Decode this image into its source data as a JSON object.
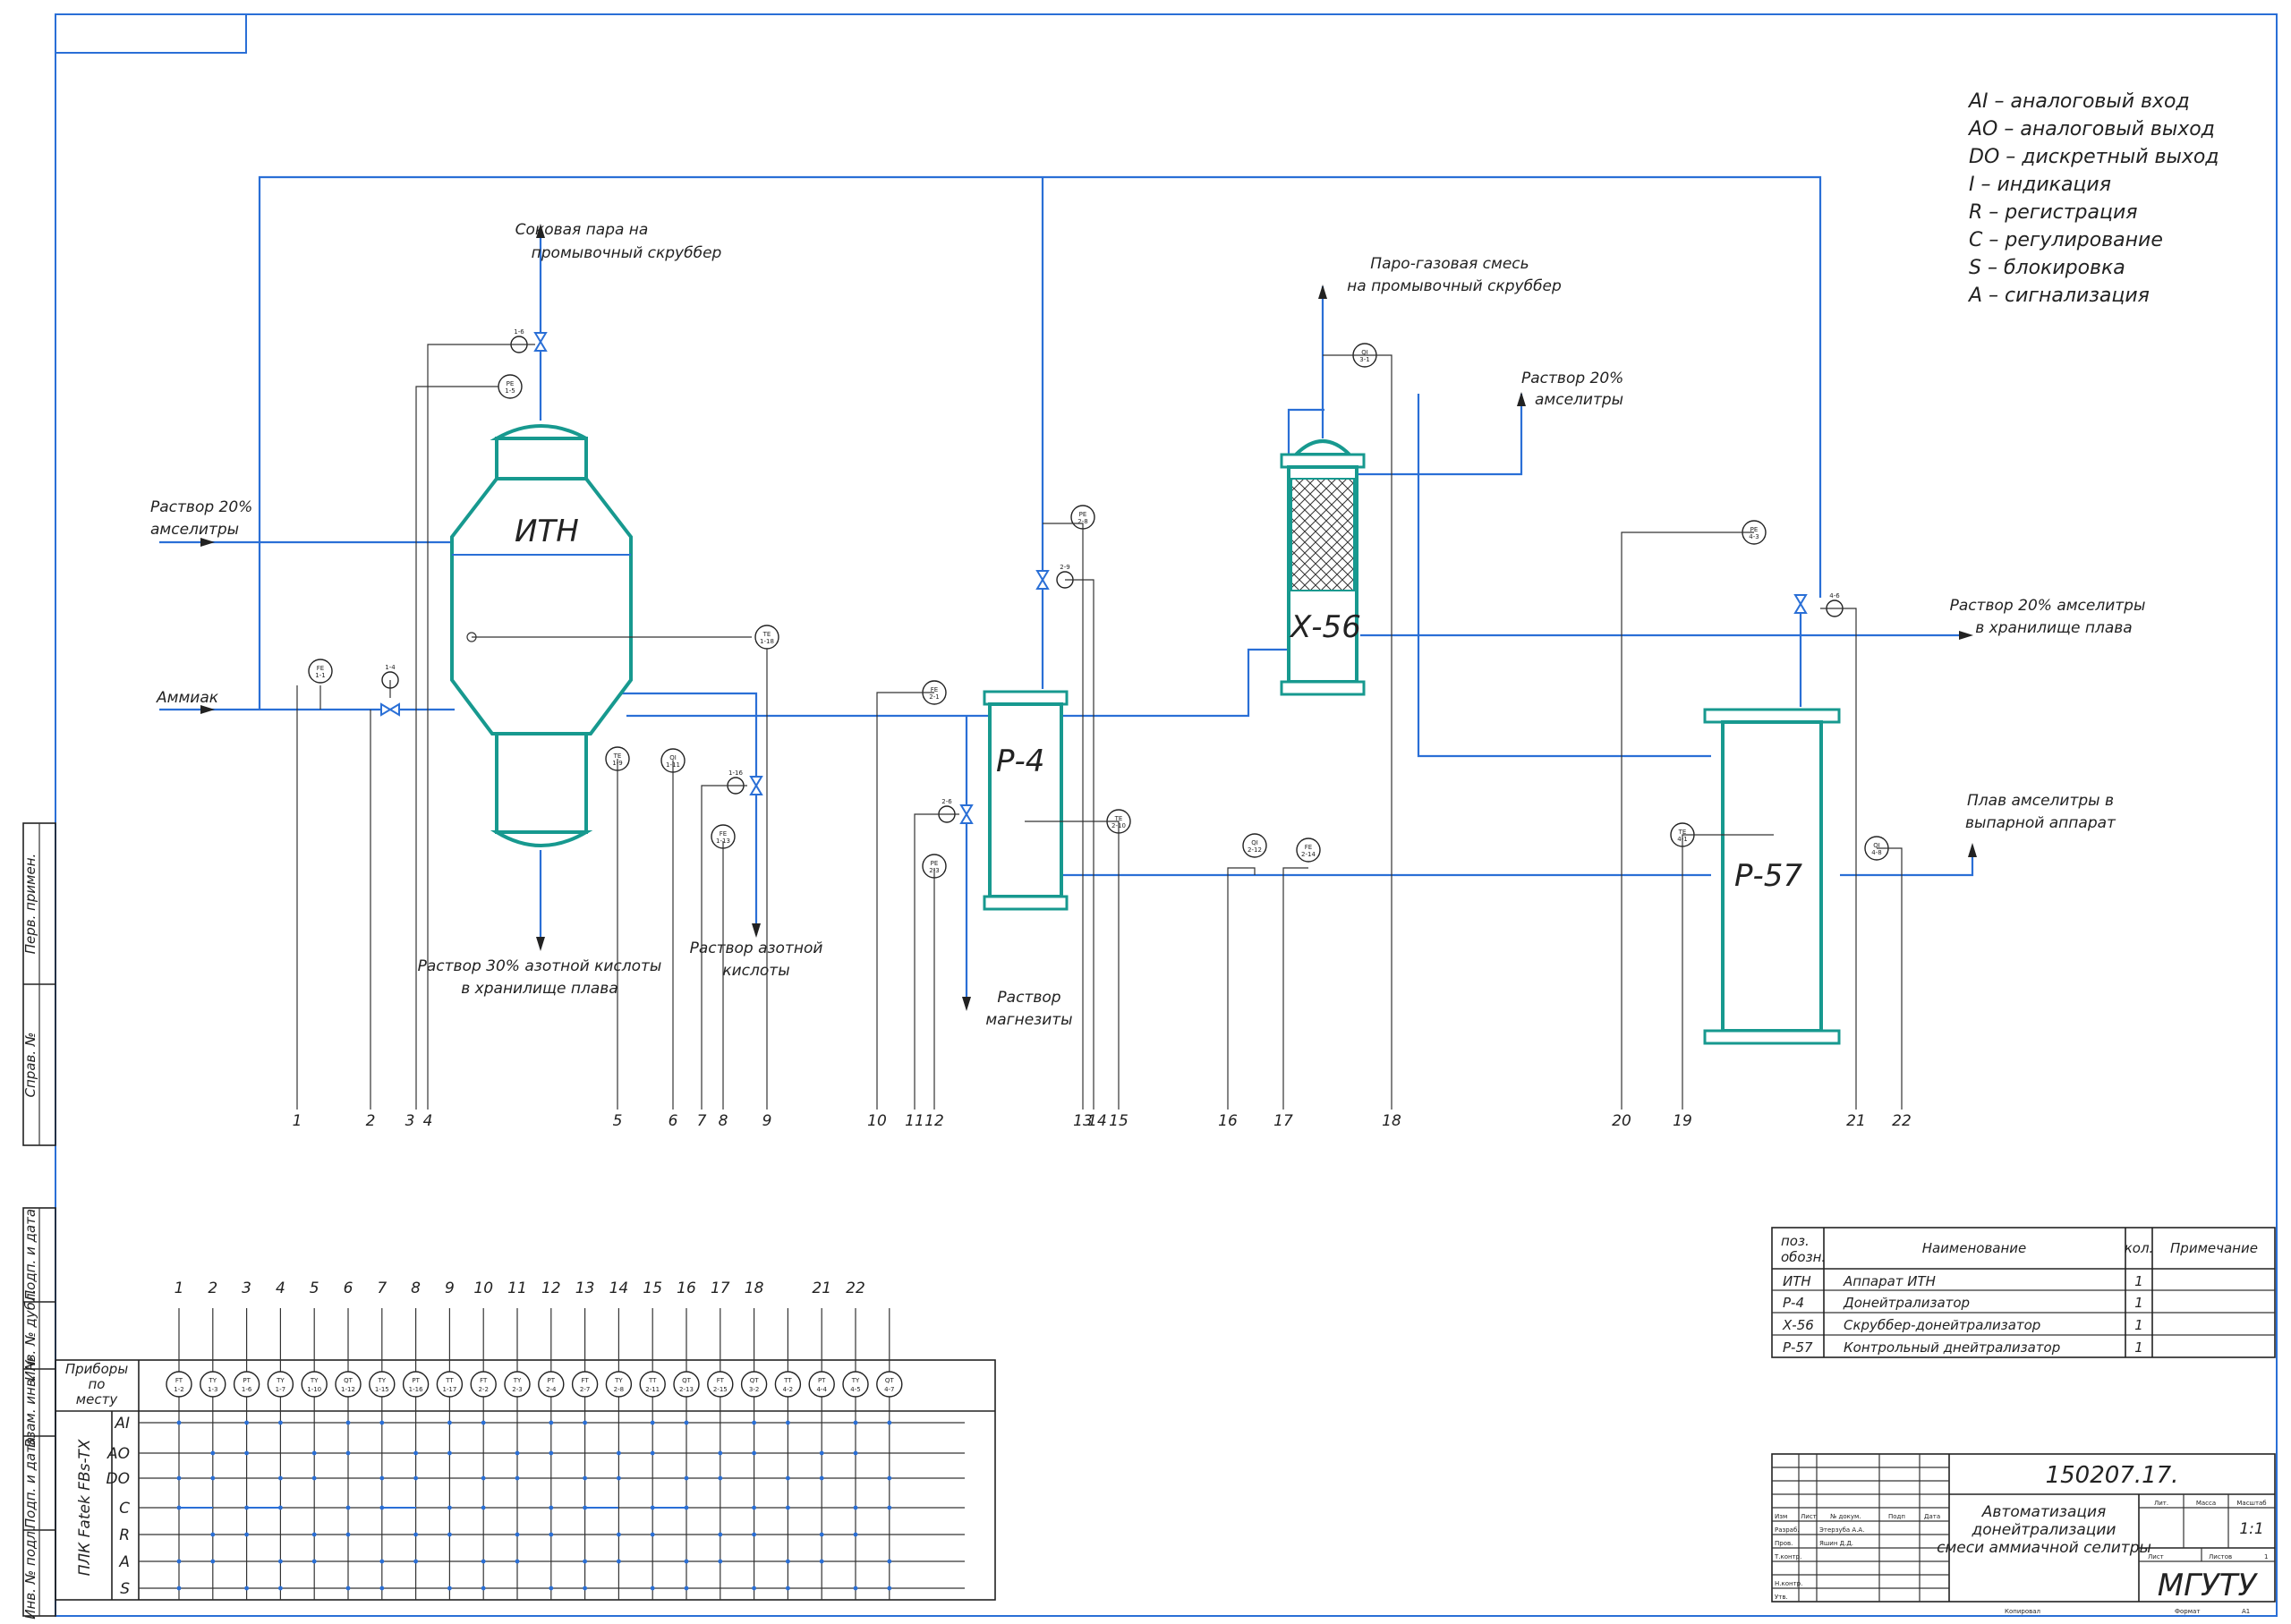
{
  "legend": [
    "AI – аналоговый вход",
    "AO – аналоговый выход",
    "DO – дискретный выход",
    "I – индикация",
    "R – регистрация",
    "C – регулирование",
    "S – блокировка",
    "A – сигнализация"
  ],
  "equipment": {
    "itn": "ИТН",
    "p4": "Р-4",
    "x56": "Х-56",
    "p57": "Р-57"
  },
  "streams": {
    "juice_steam": [
      "Соковая пара на",
      "промывочный скруббер"
    ],
    "gas_mix": [
      "Паро-газовая смесь",
      "на промывочный скруббер"
    ],
    "solution_in": [
      "Раствор 20%",
      "амселитры"
    ],
    "ammonia": "Аммиак",
    "solution_x56": [
      "Раствор 20%",
      "амселитры"
    ],
    "acid30": [
      "Раствор 30% азотной кислоты",
      "в хранилище плава"
    ],
    "nitric": [
      "Раствор азотной",
      "кислоты"
    ],
    "magnesia": [
      "Раствор",
      "магнезиты"
    ],
    "to_storage": [
      "Раствор 20% амселитры",
      "в хранилище плава"
    ],
    "melt": [
      "Плав амселитры в",
      "выпарной аппарат"
    ]
  },
  "instruments": [
    {
      "id": "i1",
      "l1": "FE",
      "l2": "1-1"
    },
    {
      "id": "i2",
      "l1": "",
      "l2": "1-4"
    },
    {
      "id": "i3",
      "l1": "",
      "l2": "1-6"
    },
    {
      "id": "i4",
      "l1": "PE",
      "l2": "1-5"
    },
    {
      "id": "i5",
      "l1": "TE",
      "l2": "1-9"
    },
    {
      "id": "i6",
      "l1": "QI",
      "l2": "1-11"
    },
    {
      "id": "i7",
      "l1": "",
      "l2": "1-16"
    },
    {
      "id": "i8",
      "l1": "FE",
      "l2": "1-13"
    },
    {
      "id": "i9",
      "l1": "TE",
      "l2": "1-18"
    },
    {
      "id": "i10",
      "l1": "FE",
      "l2": "2-1"
    },
    {
      "id": "i11",
      "l1": "",
      "l2": "2-6"
    },
    {
      "id": "i12",
      "l1": "PE",
      "l2": "2-3"
    },
    {
      "id": "i13",
      "l1": "PE",
      "l2": "2-8"
    },
    {
      "id": "i14",
      "l1": "",
      "l2": "2-9"
    },
    {
      "id": "i15",
      "l1": "TE",
      "l2": "2-10"
    },
    {
      "id": "i16",
      "l1": "QI",
      "l2": "2-12"
    },
    {
      "id": "i17",
      "l1": "FE",
      "l2": "2-14"
    },
    {
      "id": "i18",
      "l1": "QI",
      "l2": "3-1"
    },
    {
      "id": "i19",
      "l1": "TE",
      "l2": "4-1"
    },
    {
      "id": "i20",
      "l1": "PE",
      "l2": "4-3"
    },
    {
      "id": "i21",
      "l1": "",
      "l2": "4-6"
    },
    {
      "id": "i22",
      "l1": "QI",
      "l2": "4-8"
    }
  ],
  "line_numbers": [
    "1",
    "2",
    "3",
    "4",
    "5",
    "6",
    "7",
    "8",
    "9",
    "10",
    "11",
    "12",
    "13",
    "14",
    "15",
    "16",
    "17",
    "18",
    "20",
    "19",
    "21",
    "22"
  ],
  "bottom": {
    "top_numbers": [
      "1",
      "2",
      "3",
      "4",
      "5",
      "6",
      "7",
      "8",
      "9",
      "10",
      "11",
      "12",
      "13",
      "14",
      "15",
      "16",
      "17",
      "18",
      "21",
      "22"
    ],
    "devices_header": [
      "Приборы",
      "по",
      "месту"
    ],
    "plc_label": "ПЛК Fatek FBs-TX",
    "signals": [
      "AI",
      "AO",
      "DO",
      "C",
      "R",
      "A",
      "S"
    ],
    "devices": [
      {
        "l1": "FT",
        "l2": "1-2"
      },
      {
        "l1": "TY",
        "l2": "1-3"
      },
      {
        "l1": "PT",
        "l2": "1-6"
      },
      {
        "l1": "TY",
        "l2": "1-7"
      },
      {
        "l1": "TY",
        "l2": "1-10"
      },
      {
        "l1": "QT",
        "l2": "1-12"
      },
      {
        "l1": "TY",
        "l2": "1-15"
      },
      {
        "l1": "PT",
        "l2": "1-16"
      },
      {
        "l1": "TT",
        "l2": "1-17"
      },
      {
        "l1": "FT",
        "l2": "2-2"
      },
      {
        "l1": "TY",
        "l2": "2-3"
      },
      {
        "l1": "PT",
        "l2": "2-4"
      },
      {
        "l1": "FT",
        "l2": "2-7"
      },
      {
        "l1": "TY",
        "l2": "2-8"
      },
      {
        "l1": "TT",
        "l2": "2-11"
      },
      {
        "l1": "QT",
        "l2": "2-13"
      },
      {
        "l1": "FT",
        "l2": "2-15"
      },
      {
        "l1": "QT",
        "l2": "3-2"
      },
      {
        "l1": "TT",
        "l2": "4-2"
      },
      {
        "l1": "PT",
        "l2": "4-4"
      },
      {
        "l1": "TY",
        "l2": "4-5"
      },
      {
        "l1": "QT",
        "l2": "4-7"
      }
    ]
  },
  "spec": {
    "headers": [
      "поз.",
      "обозн.",
      "Наименование",
      "кол.",
      "Примечание"
    ],
    "rows": [
      {
        "pos": "ИТН",
        "name": "Аппарат ИТН",
        "qty": "1"
      },
      {
        "pos": "Р-4",
        "name": "Донейтрализатор",
        "qty": "1"
      },
      {
        "pos": "Х-56",
        "name": "Скруббер-донейтрализатор",
        "qty": "1"
      },
      {
        "pos": "Р-57",
        "name": "Контрольный днейтрализатор",
        "qty": "1"
      }
    ]
  },
  "stamp": {
    "code": "150207.17.",
    "title": [
      "Автоматизация",
      "донейтрализации",
      "смеси аммиачной селитры"
    ],
    "col_headers": [
      "Изм",
      "Лист",
      "№ докум.",
      "Подп",
      "Дата"
    ],
    "roles": [
      "Разраб.",
      "Пров.",
      "Т.контр.",
      "Н.контр.",
      "Утв."
    ],
    "names": [
      "Этерзуба А.А.",
      "Яшин Д.Д."
    ],
    "lit": "Лит.",
    "mass": "Масса",
    "scale": "Масштаб",
    "scale_value": "1:1",
    "sheet": "Лист",
    "sheets": "Листов",
    "sheets_value": "1",
    "org": "МГУТУ",
    "copied": "Копировал",
    "format": "Формат",
    "format_value": "А1"
  },
  "side_labels": [
    "Перв. примен.",
    "Справ. №",
    "Подп. и дата",
    "Инв. № дубл.",
    "Взам. инв. №",
    "Подп. и дата",
    "Инв. № подл."
  ]
}
